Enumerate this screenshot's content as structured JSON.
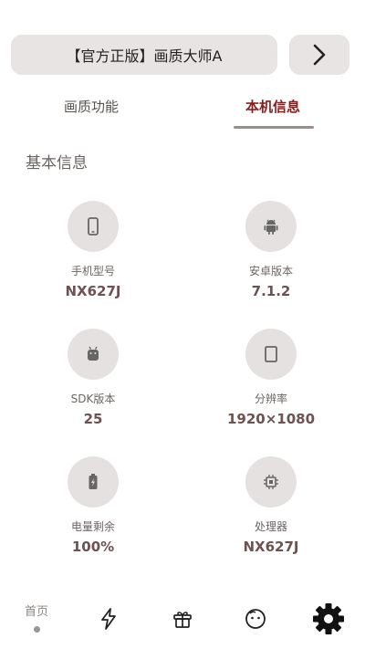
{
  "header": {
    "title": "【官方正版】画质大师A",
    "next_icon": "chevron-right-icon"
  },
  "tabs": [
    {
      "label": "画质功能",
      "active": false
    },
    {
      "label": "本机信息",
      "active": true
    }
  ],
  "section": {
    "title": "基本信息"
  },
  "info": [
    {
      "icon": "phone-icon",
      "label": "手机型号",
      "value": "NX627J"
    },
    {
      "icon": "android-icon",
      "label": "安卓版本",
      "value": "7.1.2"
    },
    {
      "icon": "android-head-icon",
      "label": "SDK版本",
      "value": "25"
    },
    {
      "icon": "screen-icon",
      "label": "分辨率",
      "value": "1920×1080"
    },
    {
      "icon": "battery-icon",
      "label": "电量剩余",
      "value": "100%"
    },
    {
      "icon": "cpu-icon",
      "label": "处理器",
      "value": "NX627J"
    }
  ],
  "nav": {
    "home_label": "首页",
    "items": [
      "home",
      "bolt-icon",
      "gift-icon",
      "face-icon",
      "gear-icon"
    ]
  },
  "colors": {
    "accent": "#8a1c1c",
    "pill_bg": "#e8e4e3",
    "circle_bg": "#e5e1e0",
    "value_text": "#6e5150"
  }
}
